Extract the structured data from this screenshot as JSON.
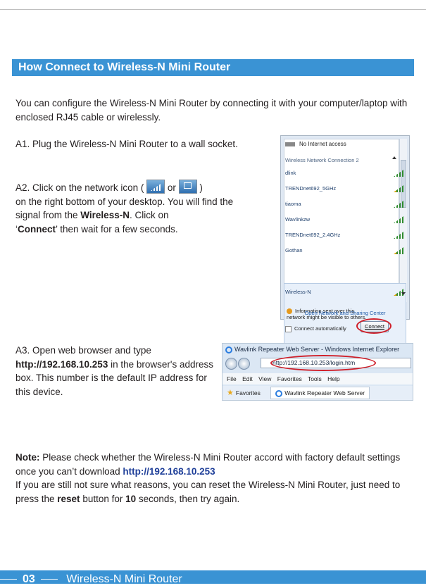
{
  "section_title": "How Connect to Wireless-N Mini Router",
  "intro": "You can configure the Wireless-N Mini Router by connecting it with your computer/laptop with enclosed RJ45 cable or wirelessly.",
  "a1": "A1. Plug the Wireless-N Mini Router to a wall socket.",
  "a2": {
    "part1": "A2. Click on the network icon (",
    "or": "or",
    "part2": ")",
    "part3": "on the right bottom of your desktop. You will find the signal from the ",
    "bold_ssid": "Wireless-N",
    "part4": ". Click on",
    "quote_open": "‘",
    "bold_connect": "Connect",
    "part5": "’ then wait for a few seconds."
  },
  "wifi_popup": {
    "status": "No Internet access",
    "category": "Wireless Network Connection 2",
    "networks": [
      "dlink",
      "TRENDnet692_5GHz",
      "tiaoma",
      "Wavlinkzw",
      "TRENDnet692_2.4GHz",
      "Gothan",
      "Wireless-N"
    ],
    "info": "Information sent over this network might be visible to others.",
    "auto_label": "Connect automatically",
    "connect_button": "Connect",
    "footer_link": "Open Network and Sharing Center"
  },
  "a3": {
    "part1": "A3.  Open web browser and type",
    "url": "http://192.168.10.253",
    "part2": " in the browser's address box. This number is the default  IP address for this device."
  },
  "browser": {
    "title": "Wavlink Repeater Web Server - Windows Internet Explorer",
    "address": "http://192.168.10.253/login.htm",
    "menu": [
      "File",
      "Edit",
      "View",
      "Favorites",
      "Tools",
      "Help"
    ],
    "favorites": "Favorites",
    "tab": "Wavlink Repeater Web Server"
  },
  "note": {
    "label": "Note:",
    "text1": "  Please check whether the Wireless-N Mini Router accord with factory default settings once you can’t download ",
    "url": "http://192.168.10.253",
    "text2": "If you are still not sure what reasons, you can reset the Wireless-N Mini Router, just need to press the ",
    "reset": "reset",
    "text3": " button for ",
    "seconds": "10",
    "text4": " seconds, then try again."
  },
  "footer": {
    "page": "03",
    "title": "Wireless-N Mini Router"
  },
  "colors": {
    "accent": "#3a93d4",
    "link": "#1f3f99",
    "highlight_ring": "#d0202a"
  }
}
